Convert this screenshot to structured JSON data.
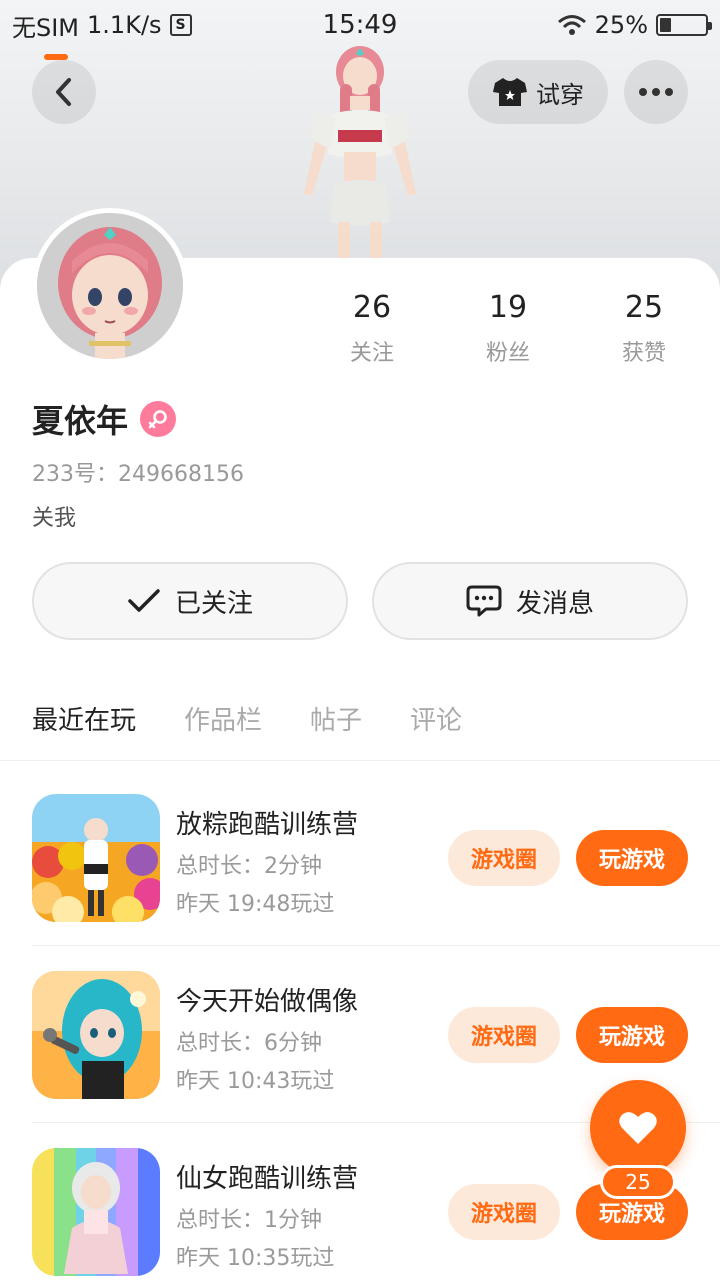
{
  "status_bar": {
    "carrier": "无SIM",
    "speed": "1.1K/s",
    "sim_badge": "S",
    "time": "15:49",
    "battery_text": "25%",
    "battery_level": 0.25
  },
  "header": {
    "try_on_label": "试穿",
    "icons": [
      "back-arrow-icon",
      "tshirt-icon",
      "more-icon"
    ]
  },
  "profile": {
    "name": "夏依年",
    "gender": "female",
    "id_line": "233号：249668156",
    "bio": "关我",
    "stats": [
      {
        "num": "26",
        "label": "关注"
      },
      {
        "num": "19",
        "label": "粉丝"
      },
      {
        "num": "25",
        "label": "获赞"
      }
    ]
  },
  "actions": {
    "follow_label": "已关注",
    "message_label": "发消息"
  },
  "tabs": [
    {
      "label": "最近在玩",
      "active": true
    },
    {
      "label": "作品栏",
      "active": false
    },
    {
      "label": "帖子",
      "active": false
    },
    {
      "label": "评论",
      "active": false
    }
  ],
  "games": [
    {
      "title": "放粽跑酷训练营",
      "duration": "总时长：2分钟",
      "last_played": "昨天 19:48玩过",
      "circle_label": "游戏圈",
      "play_label": "玩游戏"
    },
    {
      "title": "今天开始做偶像",
      "duration": "总时长：6分钟",
      "last_played": "昨天 10:43玩过",
      "circle_label": "游戏圈",
      "play_label": "玩游戏"
    },
    {
      "title": "仙女跑酷训练营",
      "duration": "总时长：1分钟",
      "last_played": "昨天 10:35玩过",
      "circle_label": "游戏圈",
      "play_label": "玩游戏"
    }
  ],
  "fab": {
    "count": "25",
    "icon": "heart-icon"
  },
  "colors": {
    "accent": "#ff6a13",
    "accent_light": "#fde9da",
    "gender_badge": "#ff7b9c"
  }
}
